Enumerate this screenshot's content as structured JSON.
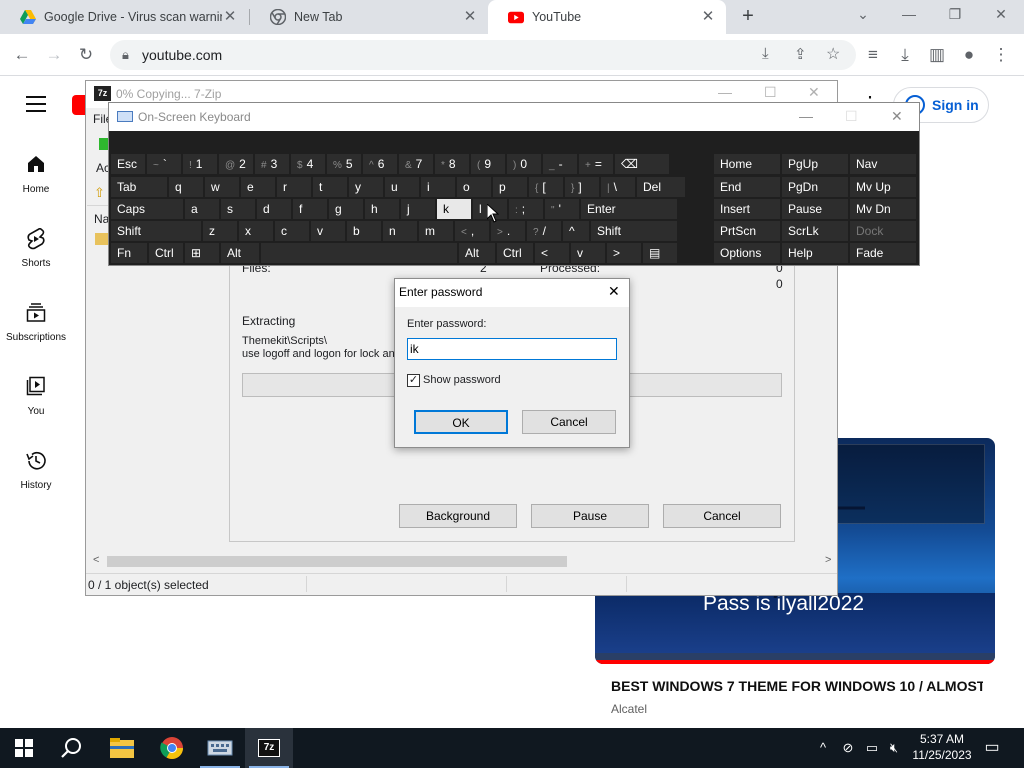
{
  "browser": {
    "tabs": [
      {
        "title": "Google Drive - Virus scan warnin",
        "icon": "google-drive-icon"
      },
      {
        "title": "New Tab",
        "icon": "chrome-icon"
      },
      {
        "title": "YouTube",
        "icon": "youtube-icon"
      }
    ],
    "url": "youtube.com"
  },
  "youtube": {
    "nav": [
      {
        "label": "Home",
        "icon": "home-icon"
      },
      {
        "label": "Shorts",
        "icon": "shorts-icon"
      },
      {
        "label": "Subscriptions",
        "icon": "subscriptions-icon"
      },
      {
        "label": "You",
        "icon": "you-icon"
      },
      {
        "label": "History",
        "icon": "history-icon"
      }
    ],
    "sign_in": "Sign in",
    "video": {
      "thumbnail_text": "Pass is ilyall2022",
      "title": "BEST WINDOWS 7 THEME FOR WINDOWS 10 / ALMOST ...",
      "channel": "Alcatel"
    }
  },
  "sevenzip": {
    "title": "0% Copying... 7-Zip",
    "menu_partial": "File",
    "toolbar_partial": "Ac",
    "list_header_partial": "Na",
    "files_label": "Files:",
    "files_value": "2",
    "processed_label": "Processed:",
    "processed_value": "0",
    "second_value": "0",
    "extracting_label": "Extracting",
    "path_line1": "Themekit\\Scripts\\",
    "path_line2": "use logoff and logon for lock and",
    "buttons": {
      "background": "Background",
      "pause": "Pause",
      "cancel": "Cancel"
    },
    "status": "0 / 1 object(s) selected"
  },
  "osk": {
    "title": "On-Screen Keyboard",
    "row1": [
      {
        "main": "Esc"
      },
      {
        "sub": "~",
        "main": "`"
      },
      {
        "sub": "!",
        "main": "1"
      },
      {
        "sub": "@",
        "main": "2"
      },
      {
        "sub": "#",
        "main": "3"
      },
      {
        "sub": "$",
        "main": "4"
      },
      {
        "sub": "%",
        "main": "5"
      },
      {
        "sub": "^",
        "main": "6"
      },
      {
        "sub": "&",
        "main": "7"
      },
      {
        "sub": "*",
        "main": "8"
      },
      {
        "sub": "(",
        "main": "9"
      },
      {
        "sub": ")",
        "main": "0"
      },
      {
        "sub": "_",
        "main": "-"
      },
      {
        "sub": "+",
        "main": "="
      },
      {
        "main": "⌫"
      }
    ],
    "row2": [
      {
        "main": "Tab"
      },
      {
        "main": "q"
      },
      {
        "main": "w"
      },
      {
        "main": "e"
      },
      {
        "main": "r"
      },
      {
        "main": "t"
      },
      {
        "main": "y"
      },
      {
        "main": "u"
      },
      {
        "main": "i"
      },
      {
        "main": "o"
      },
      {
        "main": "p"
      },
      {
        "sub": "{",
        "main": "["
      },
      {
        "sub": "}",
        "main": "]"
      },
      {
        "sub": "|",
        "main": "\\"
      },
      {
        "main": "Del"
      }
    ],
    "row3": [
      {
        "main": "Caps"
      },
      {
        "main": "a"
      },
      {
        "main": "s"
      },
      {
        "main": "d"
      },
      {
        "main": "f"
      },
      {
        "main": "g"
      },
      {
        "main": "h"
      },
      {
        "main": "j"
      },
      {
        "main": "k"
      },
      {
        "main": "l"
      },
      {
        "sub": ":",
        "main": ";"
      },
      {
        "sub": "\"",
        "main": "'"
      },
      {
        "main": "Enter"
      }
    ],
    "row4": [
      {
        "main": "Shift"
      },
      {
        "main": "z"
      },
      {
        "main": "x"
      },
      {
        "main": "c"
      },
      {
        "main": "v"
      },
      {
        "main": "b"
      },
      {
        "main": "n"
      },
      {
        "main": "m"
      },
      {
        "sub": "<",
        "main": ","
      },
      {
        "sub": ">",
        "main": "."
      },
      {
        "sub": "?",
        "main": "/"
      },
      {
        "main": "^"
      },
      {
        "main": "Shift"
      }
    ],
    "row5": [
      {
        "main": "Fn"
      },
      {
        "main": "Ctrl"
      },
      {
        "main": "⊞"
      },
      {
        "main": "Alt"
      },
      {
        "main": ""
      },
      {
        "main": "Alt"
      },
      {
        "main": "Ctrl"
      },
      {
        "main": "<"
      },
      {
        "main": "v"
      },
      {
        "main": ">"
      },
      {
        "main": "▤"
      }
    ],
    "nav_keys": [
      [
        "Home",
        "PgUp",
        "Nav"
      ],
      [
        "End",
        "PgDn",
        "Mv Up"
      ],
      [
        "Insert",
        "Pause",
        "Mv Dn"
      ],
      [
        "PrtScn",
        "ScrLk",
        "Dock"
      ],
      [
        "Options",
        "Help",
        "Fade"
      ]
    ],
    "highlighted_key": "k"
  },
  "password_dialog": {
    "title": "Enter password",
    "label": "Enter password:",
    "value": "ik",
    "show_password": "Show password",
    "show_password_checked": true,
    "ok": "OK",
    "cancel": "Cancel"
  },
  "taskbar": {
    "time": "5:37 AM",
    "date": "11/25/2023"
  }
}
